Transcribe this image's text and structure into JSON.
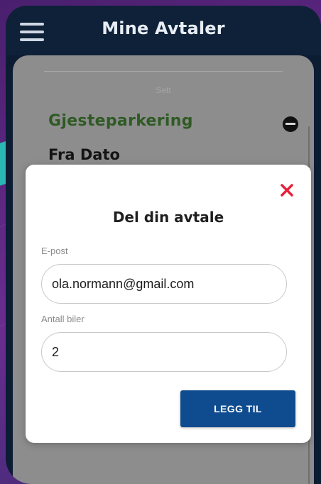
{
  "header": {
    "title": "Mine Avtaler",
    "menu_icon": "hamburger-menu-icon"
  },
  "background_sheet": {
    "subtitle": "Sett",
    "category": "Gjesteparkering",
    "date_label": "Fra Dato",
    "toggle_icon": "minus-circle-icon"
  },
  "modal": {
    "title": "Del din avtale",
    "close_icon": "close-x-icon",
    "email": {
      "label": "E-post",
      "value": "ola.normann@gmail.com"
    },
    "cars": {
      "label": "Antall biler",
      "value": "2"
    },
    "submit_label": "LEGG TIL"
  },
  "colors": {
    "header_bg": "#0f2138",
    "accent_red": "#e8203a",
    "button_blue": "#0f4c8f",
    "green_text": "#2f5a24",
    "backdrop_purple": "#5b2a7c",
    "backdrop_teal": "#2bb7b3"
  }
}
